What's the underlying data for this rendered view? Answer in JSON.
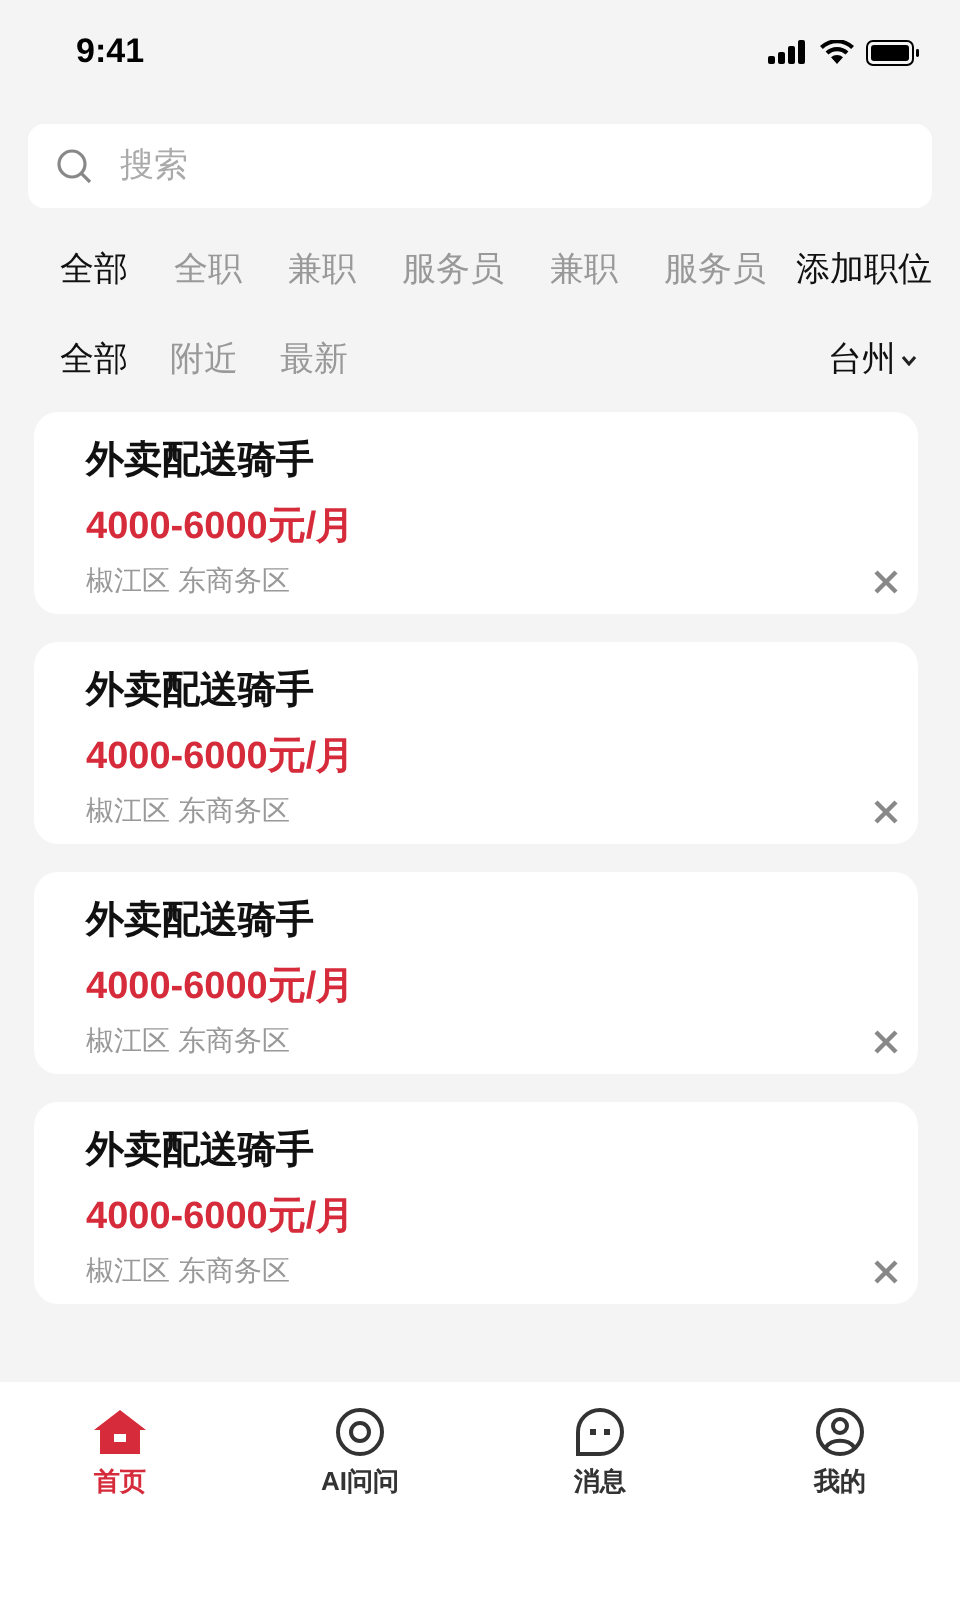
{
  "status_bar": {
    "time": "9:41"
  },
  "search": {
    "placeholder": "搜索"
  },
  "categories": [
    {
      "label": "全部",
      "selected": true
    },
    {
      "label": "全职",
      "selected": false
    },
    {
      "label": "兼职",
      "selected": false
    },
    {
      "label": "服务员",
      "selected": false
    },
    {
      "label": "兼职",
      "selected": false
    },
    {
      "label": "服务员",
      "selected": false
    }
  ],
  "add_category": "添加职位",
  "filters": [
    {
      "label": "全部",
      "selected": true
    },
    {
      "label": "附近",
      "selected": false
    },
    {
      "label": "最新",
      "selected": false
    }
  ],
  "city": "台州",
  "jobs": [
    {
      "title": "外卖配送骑手",
      "salary": "4000-6000元/月",
      "location": "椒江区 东商务区"
    },
    {
      "title": "外卖配送骑手",
      "salary": "4000-6000元/月",
      "location": "椒江区 东商务区"
    },
    {
      "title": "外卖配送骑手",
      "salary": "4000-6000元/月",
      "location": "椒江区 东商务区"
    },
    {
      "title": "外卖配送骑手",
      "salary": "4000-6000元/月",
      "location": "椒江区 东商务区"
    }
  ],
  "tab_bar": [
    {
      "kind": "home",
      "label": "首页",
      "selected": true
    },
    {
      "kind": "ai",
      "label": "AI问问",
      "selected": false
    },
    {
      "kind": "chat",
      "label": "消息",
      "selected": false
    },
    {
      "kind": "user",
      "label": "我的",
      "selected": false
    }
  ]
}
